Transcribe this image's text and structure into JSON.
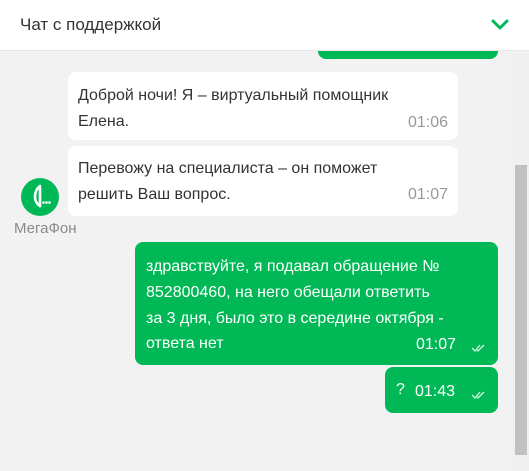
{
  "header": {
    "title": "Чат с поддержкой",
    "collapse_icon": "chevron-down-icon",
    "accent_color": "#00b956"
  },
  "operator": {
    "name": "МегаФон",
    "avatar_icon": "megafon-logo-icon"
  },
  "messages": [
    {
      "from": "operator",
      "text": "Доброй ночи! Я – виртуальный помощник Елена.",
      "line1": "Доброй ночи! Я – виртуальный помощник",
      "line2": "Елена.",
      "time": "01:06"
    },
    {
      "from": "operator",
      "text": "Перевожу на специалиста – он поможет решить Ваш вопрос.",
      "line1": "Перевожу на специалиста – он поможет",
      "line2": "решить Ваш вопрос.",
      "time": "01:07"
    },
    {
      "from": "user",
      "line1": "здравствуйте, я подавал обращение №",
      "line2": "852800460, на него обещали ответить",
      "line3": "за 3 дня, было это в середине октября -",
      "line4": "ответа нет",
      "time": "01:07",
      "status_icon": "double-check-icon"
    },
    {
      "from": "user",
      "text": "?",
      "time": "01:43",
      "status_icon": "double-check-icon"
    }
  ]
}
